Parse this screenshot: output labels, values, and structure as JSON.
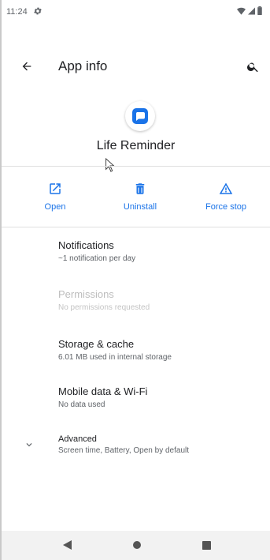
{
  "status_bar": {
    "time": "11:24",
    "gear_icon": "gear-icon",
    "wifi_icon": "wifi-icon",
    "signal_icon": "signal-icon",
    "battery_icon": "battery-icon"
  },
  "app_bar": {
    "title": "App info",
    "back_icon": "arrow-back-icon",
    "search_icon": "search-icon"
  },
  "app": {
    "name": "Life Reminder",
    "icon": "chat-bubble-icon",
    "icon_color": "#1a73e8"
  },
  "actions": [
    {
      "label": "Open",
      "icon": "open-in-new-icon"
    },
    {
      "label": "Uninstall",
      "icon": "trash-icon"
    },
    {
      "label": "Force stop",
      "icon": "warning-icon"
    }
  ],
  "preferences": [
    {
      "title": "Notifications",
      "summary": "~1 notification per day",
      "enabled": true
    },
    {
      "title": "Permissions",
      "summary": "No permissions requested",
      "enabled": false
    },
    {
      "title": "Storage & cache",
      "summary": "6.01 MB used in internal storage",
      "enabled": true
    },
    {
      "title": "Mobile data & Wi-Fi",
      "summary": "No data used",
      "enabled": true
    },
    {
      "title": "Advanced",
      "summary": "Screen time, Battery, Open by default",
      "enabled": true
    }
  ],
  "nav_bar": {
    "back_icon": "nav-back-icon",
    "home_icon": "nav-home-icon",
    "recents_icon": "nav-recents-icon"
  },
  "colors": {
    "accent": "#1a73e8",
    "text_primary": "#202124",
    "text_secondary": "#5f6368",
    "disabled": "#bdbdbd"
  }
}
